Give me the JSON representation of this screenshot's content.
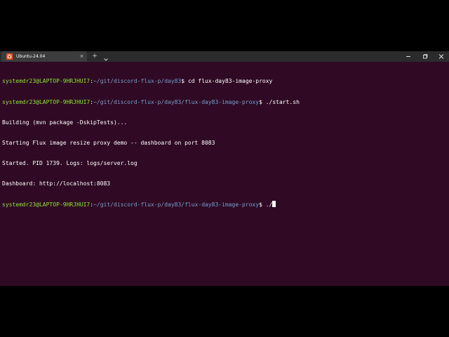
{
  "window": {
    "tab_title": "Ubuntu-24.04",
    "tab_close_glyph": "×",
    "new_tab_glyph": "+",
    "colors": {
      "background": "#300a24",
      "titlebar": "#2b2b2b",
      "accent": "#e95420",
      "user": "#8ae234",
      "path": "#729fcf"
    }
  },
  "terminal": {
    "lines": [
      {
        "user": "systemdr23@LAPTOP-9HRJHUI7",
        "sep": ":",
        "path": "~/git/discord-flux-p/day83",
        "prompt": "$ ",
        "cmd": "cd flux-day83-image-proxy"
      },
      {
        "user": "systemdr23@LAPTOP-9HRJHUI7",
        "sep": ":",
        "path": "~/git/discord-flux-p/day83/flux-day83-image-proxy",
        "prompt": "$ ",
        "cmd": "./start.sh"
      },
      {
        "text": "Building (mvn package -DskipTests)..."
      },
      {
        "text": "Starting Flux image resize proxy demo -- dashboard on port 8083"
      },
      {
        "text": "Started. PID 1739. Logs: logs/server.log"
      },
      {
        "text": "Dashboard: http://localhost:8083"
      },
      {
        "user": "systemdr23@LAPTOP-9HRJHUI7",
        "sep": ":",
        "path": "~/git/discord-flux-p/day83/flux-day83-image-proxy",
        "prompt": "$ ",
        "cmd": "./"
      }
    ]
  }
}
